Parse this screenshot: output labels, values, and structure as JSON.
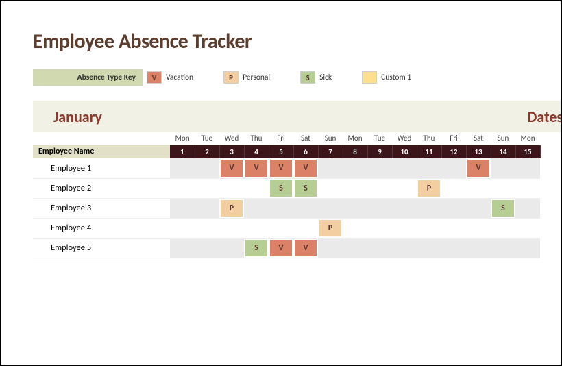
{
  "title": "Employee Absence Tracker",
  "key": {
    "header": "Absence Type Key",
    "items": [
      {
        "code": "V",
        "label": "Vacation",
        "swatchClass": "sw-v"
      },
      {
        "code": "P",
        "label": "Personal",
        "swatchClass": "sw-p"
      },
      {
        "code": "S",
        "label": "Sick",
        "swatchClass": "sw-s"
      },
      {
        "code": "",
        "label": "Custom 1",
        "swatchClass": "sw-c1"
      }
    ]
  },
  "month": "January",
  "dates_heading": "Dates o",
  "headers": {
    "employee_name": "Employee Name"
  },
  "days": [
    {
      "dow": "Mon",
      "num": "1"
    },
    {
      "dow": "Tue",
      "num": "2"
    },
    {
      "dow": "Wed",
      "num": "3"
    },
    {
      "dow": "Thu",
      "num": "4"
    },
    {
      "dow": "Fri",
      "num": "5"
    },
    {
      "dow": "Sat",
      "num": "6"
    },
    {
      "dow": "Sun",
      "num": "7"
    },
    {
      "dow": "Mon",
      "num": "8"
    },
    {
      "dow": "Tue",
      "num": "9"
    },
    {
      "dow": "Wed",
      "num": "10"
    },
    {
      "dow": "Thu",
      "num": "11"
    },
    {
      "dow": "Fri",
      "num": "12"
    },
    {
      "dow": "Sat",
      "num": "13"
    },
    {
      "dow": "Sun",
      "num": "14"
    },
    {
      "dow": "Mon",
      "num": "15"
    }
  ],
  "employees": [
    {
      "name": "Employee 1",
      "cells": [
        "",
        "",
        "V",
        "V",
        "V",
        "V",
        "",
        "",
        "",
        "",
        "",
        "",
        "V",
        "",
        ""
      ]
    },
    {
      "name": "Employee 2",
      "cells": [
        "",
        "",
        "",
        "",
        "S",
        "S",
        "",
        "",
        "",
        "",
        "P",
        "",
        "",
        "",
        ""
      ]
    },
    {
      "name": "Employee 3",
      "cells": [
        "",
        "",
        "P",
        "",
        "",
        "",
        "",
        "",
        "",
        "",
        "",
        "",
        "",
        "S",
        ""
      ]
    },
    {
      "name": "Employee 4",
      "cells": [
        "",
        "",
        "",
        "",
        "",
        "",
        "P",
        "",
        "",
        "",
        "",
        "",
        "",
        "",
        ""
      ]
    },
    {
      "name": "Employee 5",
      "cells": [
        "",
        "",
        "",
        "S",
        "V",
        "V",
        "",
        "",
        "",
        "",
        "",
        "",
        "",
        "",
        ""
      ]
    }
  ],
  "chart_data": {
    "type": "table",
    "title": "Employee Absence Tracker — January",
    "columns": [
      "Employee Name",
      "1",
      "2",
      "3",
      "4",
      "5",
      "6",
      "7",
      "8",
      "9",
      "10",
      "11",
      "12",
      "13",
      "14",
      "15"
    ],
    "rows": [
      [
        "Employee 1",
        "",
        "",
        "V",
        "V",
        "V",
        "V",
        "",
        "",
        "",
        "",
        "",
        "",
        "V",
        "",
        ""
      ],
      [
        "Employee 2",
        "",
        "",
        "",
        "",
        "S",
        "S",
        "",
        "",
        "",
        "",
        "P",
        "",
        "",
        "",
        ""
      ],
      [
        "Employee 3",
        "",
        "",
        "P",
        "",
        "",
        "",
        "",
        "",
        "",
        "",
        "",
        "",
        "",
        "S",
        ""
      ],
      [
        "Employee 4",
        "",
        "",
        "",
        "",
        "",
        "",
        "P",
        "",
        "",
        "",
        "",
        "",
        "",
        "",
        ""
      ],
      [
        "Employee 5",
        "",
        "",
        "",
        "S",
        "V",
        "V",
        "",
        "",
        "",
        "",
        "",
        "",
        "",
        "",
        ""
      ]
    ],
    "legend": {
      "V": "Vacation",
      "P": "Personal",
      "S": "Sick"
    }
  }
}
